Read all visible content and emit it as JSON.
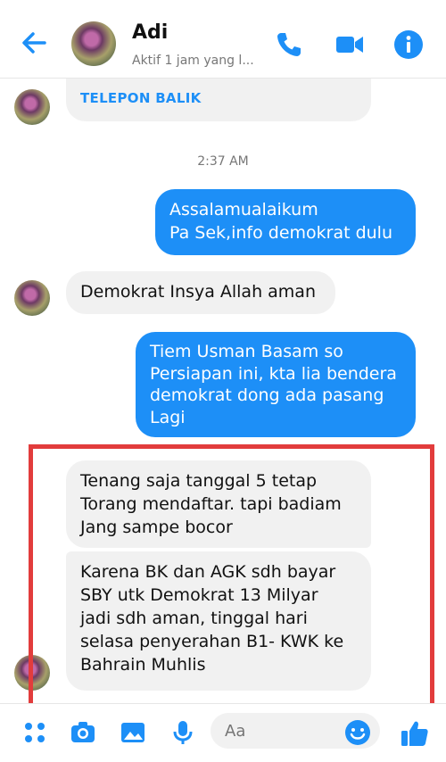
{
  "header": {
    "name": "Adi",
    "status": "Aktif 1 jam yang l..."
  },
  "chat": {
    "callback_label": "TELEPON BALIK",
    "timestamp": "2:37 AM",
    "messages": [
      {
        "direction": "outgoing",
        "lines": [
          "Assalamualaikum",
          "Pa Sek,info demokrat dulu"
        ]
      },
      {
        "direction": "incoming",
        "lines": [
          "Demokrat Insya Allah aman"
        ]
      },
      {
        "direction": "outgoing",
        "lines": [
          "Tiem Usman Basam so",
          "Persiapan ini, kta lia bendera",
          "demokrat dong ada pasang",
          "Lagi"
        ]
      },
      {
        "direction": "incoming",
        "lines": [
          "Tenang saja tanggal 5 tetap",
          "Torang mendaftar. tapi badiam",
          "Jang sampe bocor"
        ]
      },
      {
        "direction": "incoming",
        "lines": [
          "Karena BK dan AGK sdh bayar",
          "SBY utk Demokrat 13 Milyar",
          "jadi sdh aman, tinggal hari",
          "selasa penyerahan B1- KWK ke",
          "Bahrain Muhlis"
        ]
      }
    ]
  },
  "composer": {
    "placeholder": "Aa"
  },
  "colors": {
    "accent": "#1d8ff7",
    "highlight_box": "#e23c3c"
  },
  "icons": [
    "back-arrow-icon",
    "phone-icon",
    "video-camera-icon",
    "info-icon",
    "menu-dots-icon",
    "camera-icon",
    "gallery-icon",
    "microphone-icon",
    "emoji-icon",
    "thumbs-up-icon"
  ]
}
